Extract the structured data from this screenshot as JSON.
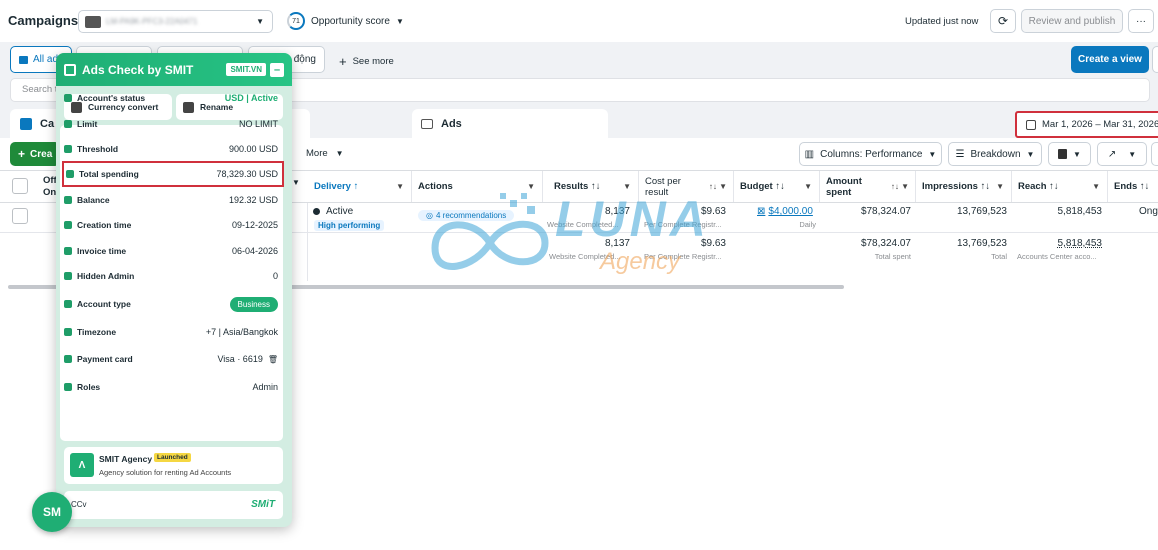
{
  "topbar": {
    "title": "Campaigns",
    "account_name": "LM-PA9K-PFC3-22A0471",
    "opportunity_score": "71",
    "opportunity_label": "Opportunity score",
    "updated": "Updated just now",
    "review_label": "Review and publish",
    "more_label": "···"
  },
  "filters": {
    "all_ads": "All ad",
    "tab_partial": "n động",
    "see_more": "See more",
    "create_view": "Create a view",
    "search_placeholder": "Search t"
  },
  "level_tabs": {
    "campaigns": "Ca",
    "ads": "Ads"
  },
  "date_range": "Mar 1, 2026 – Mar 31, 2026",
  "toolbar": {
    "create": "Crea",
    "more": "More",
    "columns": "Columns: Performance",
    "breakdown": "Breakdown"
  },
  "table": {
    "headers": {
      "off_on": "Off/\nOn",
      "delivery": "Delivery ↑",
      "actions": "Actions",
      "results": "Results ↑↓",
      "cost_per_result": "Cost per result",
      "budget": "Budget ↑↓",
      "amount_spent": "Amount spent",
      "impressions": "Impressions ↑↓",
      "reach": "Reach ↑↓",
      "ends": "Ends ↑↓"
    },
    "row": {
      "delivery": "Active",
      "delivery_badge": "High performing",
      "actions": "4 recommendations",
      "results": "8,137",
      "results_sub": "Website Completed...",
      "cost": "$9.63",
      "cost_sub": "Per Complete Registr...",
      "budget": "$4,000.00",
      "budget_sub": "Daily",
      "amount": "$78,324.07",
      "impressions": "13,769,523",
      "reach": "5,818,453",
      "ends": "Ongo"
    },
    "totals": {
      "results": "8,137",
      "results_sub": "Website Completed...",
      "cost": "$9.63",
      "cost_sub": "Per Complete Registr...",
      "amount": "$78,324.07",
      "amount_sub": "Total spent",
      "impressions": "13,769,523",
      "impressions_sub": "Total",
      "reach": "5,818,453",
      "reach_sub": "Accounts Center acco..."
    }
  },
  "watermark": {
    "brand": "LUNA",
    "sub": "Agency"
  },
  "panel": {
    "title": "Ads Check by SMIT",
    "badge": "SMIT.VN",
    "minimize": "–",
    "currency_convert": "Currency convert",
    "rename": "Rename",
    "rows": [
      {
        "label": "Account's status",
        "value": "USD | Active"
      },
      {
        "label": "Limit",
        "value": "NO LIMIT"
      },
      {
        "label": "Threshold",
        "value": "900.00 USD"
      },
      {
        "label": "Total spending",
        "value": "78,329.30 USD"
      },
      {
        "label": "Balance",
        "value": "192.32 USD"
      },
      {
        "label": "Creation time",
        "value": "09-12-2025"
      },
      {
        "label": "Invoice time",
        "value": "06-04-2026"
      },
      {
        "label": "Hidden Admin",
        "value": "0"
      },
      {
        "label": "Account type",
        "value": "Business"
      },
      {
        "label": "Timezone",
        "value": "+7 | Asia/Bangkok"
      },
      {
        "label": "Payment card",
        "value": "Visa · 6619"
      },
      {
        "label": "Roles",
        "value": "Admin"
      }
    ],
    "agency_name": "SMIT Agency",
    "agency_badge": "Launched",
    "agency_desc": "Agency solution for renting Ad Accounts",
    "footer_left": "CCv",
    "footer_logo": "SMiT"
  },
  "float_button": "SM",
  "colors": {
    "primary": "#0a78be",
    "green": "#1fae74",
    "red_highlight": "#d0303c"
  }
}
